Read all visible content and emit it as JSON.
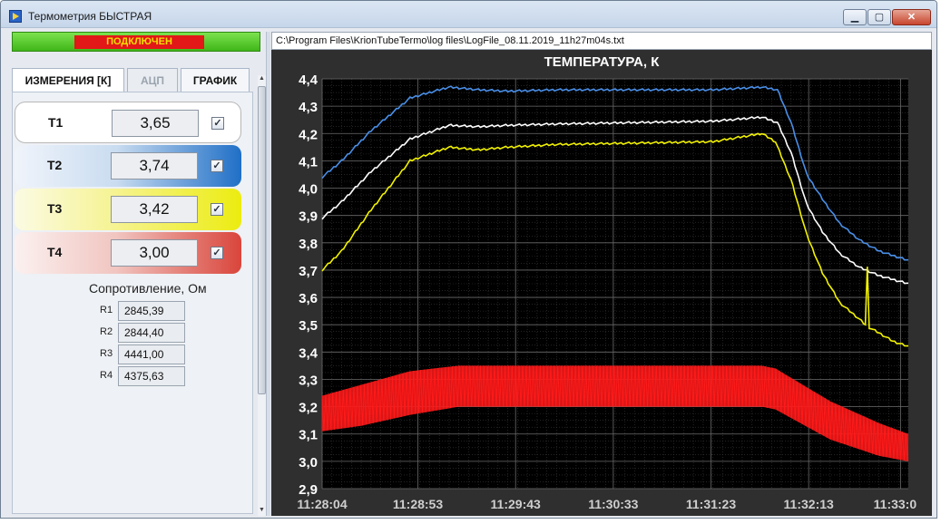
{
  "window": {
    "title": "Термометрия БЫСТРАЯ",
    "min_label": "▁",
    "max_label": "▢",
    "close_label": "✕"
  },
  "status": {
    "label": "ПОДКЛЮЧЕН",
    "color": "#e21717"
  },
  "tabs": [
    {
      "label": "ИЗМЕРЕНИЯ [К]",
      "state": "active"
    },
    {
      "label": "АЦП",
      "state": "disabled"
    },
    {
      "label": "ГРАФИК",
      "state": "normal"
    }
  ],
  "sensors": [
    {
      "name": "T1",
      "value": "3,65",
      "checked": "✓",
      "color": "#ffffff"
    },
    {
      "name": "T2",
      "value": "3,74",
      "checked": "✓",
      "color": "#1f6fc7"
    },
    {
      "name": "T3",
      "value": "3,42",
      "checked": "✓",
      "color": "#ecec10"
    },
    {
      "name": "T4",
      "value": "3,00",
      "checked": "✓",
      "color": "#d9453b"
    }
  ],
  "resistance": {
    "title": "Сопротивление, Ом",
    "rows": [
      {
        "label": "R1",
        "value": "2845,39"
      },
      {
        "label": "R2",
        "value": "2844,40"
      },
      {
        "label": "R3",
        "value": "4441,00"
      },
      {
        "label": "R4",
        "value": "4375,63"
      }
    ]
  },
  "file_path": "C:\\Program Files\\KrionTubeTermo\\log files\\LogFile_08.11.2019_11h27m04s.txt",
  "chart_data": {
    "type": "line",
    "title": "ТЕМПЕРАТУРА, К",
    "xlabel": "",
    "ylabel": "",
    "ylim": [
      2.9,
      4.4
    ],
    "grid": true,
    "background": "#000000",
    "y_ticks": [
      "2,9",
      "3,0",
      "3,1",
      "3,2",
      "3,3",
      "3,4",
      "3,5",
      "3,6",
      "3,7",
      "3,8",
      "3,9",
      "4,0",
      "4,1",
      "4,2",
      "4,3",
      "4,4"
    ],
    "y_tick_values": [
      2.9,
      3.0,
      3.1,
      3.2,
      3.3,
      3.4,
      3.5,
      3.6,
      3.7,
      3.8,
      3.9,
      4.0,
      4.1,
      4.2,
      4.3,
      4.4
    ],
    "x_ticks": [
      "11:28:04",
      "11:28:53",
      "11:29:43",
      "11:30:33",
      "11:31:23",
      "11:32:13",
      "11:33:0"
    ],
    "x_range_seconds_from_first_tick": [
      0,
      300
    ],
    "x_tick_seconds_from_first_tick": [
      0,
      49,
      99,
      149,
      199,
      249,
      296
    ],
    "series": [
      {
        "color": "#4a8fe8",
        "points": [
          [
            0,
            4.04
          ],
          [
            10,
            4.1
          ],
          [
            25,
            4.21
          ],
          [
            45,
            4.33
          ],
          [
            65,
            4.37
          ],
          [
            80,
            4.36
          ],
          [
            95,
            4.355
          ],
          [
            120,
            4.36
          ],
          [
            160,
            4.36
          ],
          [
            200,
            4.36
          ],
          [
            225,
            4.37
          ],
          [
            233,
            4.36
          ],
          [
            240,
            4.24
          ],
          [
            248,
            4.05
          ],
          [
            256,
            3.96
          ],
          [
            265,
            3.87
          ],
          [
            275,
            3.81
          ],
          [
            285,
            3.77
          ],
          [
            300,
            3.735
          ]
        ]
      },
      {
        "color": "#ffffff",
        "points": [
          [
            0,
            3.89
          ],
          [
            10,
            3.95
          ],
          [
            25,
            4.06
          ],
          [
            45,
            4.18
          ],
          [
            65,
            4.23
          ],
          [
            80,
            4.225
          ],
          [
            95,
            4.23
          ],
          [
            120,
            4.235
          ],
          [
            160,
            4.24
          ],
          [
            200,
            4.245
          ],
          [
            225,
            4.26
          ],
          [
            233,
            4.24
          ],
          [
            240,
            4.13
          ],
          [
            248,
            3.94
          ],
          [
            256,
            3.84
          ],
          [
            265,
            3.76
          ],
          [
            275,
            3.71
          ],
          [
            285,
            3.68
          ],
          [
            300,
            3.65
          ]
        ]
      },
      {
        "color": "#f2f200",
        "points": [
          [
            0,
            3.7
          ],
          [
            10,
            3.77
          ],
          [
            25,
            3.92
          ],
          [
            45,
            4.1
          ],
          [
            65,
            4.15
          ],
          [
            80,
            4.14
          ],
          [
            95,
            4.15
          ],
          [
            120,
            4.16
          ],
          [
            160,
            4.165
          ],
          [
            200,
            4.17
          ],
          [
            225,
            4.2
          ],
          [
            232,
            4.17
          ],
          [
            240,
            4.03
          ],
          [
            248,
            3.83
          ],
          [
            256,
            3.69
          ],
          [
            265,
            3.58
          ],
          [
            275,
            3.52
          ],
          [
            278,
            3.5
          ],
          [
            279,
            3.71
          ],
          [
            280,
            3.49
          ],
          [
            285,
            3.47
          ],
          [
            292,
            3.44
          ],
          [
            300,
            3.42
          ]
        ]
      },
      {
        "color": "#ff1a1a",
        "band": true,
        "upper": [
          [
            0,
            3.24
          ],
          [
            20,
            3.28
          ],
          [
            45,
            3.33
          ],
          [
            70,
            3.35
          ],
          [
            225,
            3.35
          ],
          [
            232,
            3.34
          ],
          [
            260,
            3.22
          ],
          [
            285,
            3.14
          ],
          [
            300,
            3.1
          ]
        ],
        "lower": [
          [
            0,
            3.11
          ],
          [
            20,
            3.13
          ],
          [
            45,
            3.17
          ],
          [
            70,
            3.2
          ],
          [
            225,
            3.2
          ],
          [
            232,
            3.19
          ],
          [
            260,
            3.08
          ],
          [
            285,
            3.02
          ],
          [
            300,
            3.0
          ]
        ]
      }
    ]
  }
}
